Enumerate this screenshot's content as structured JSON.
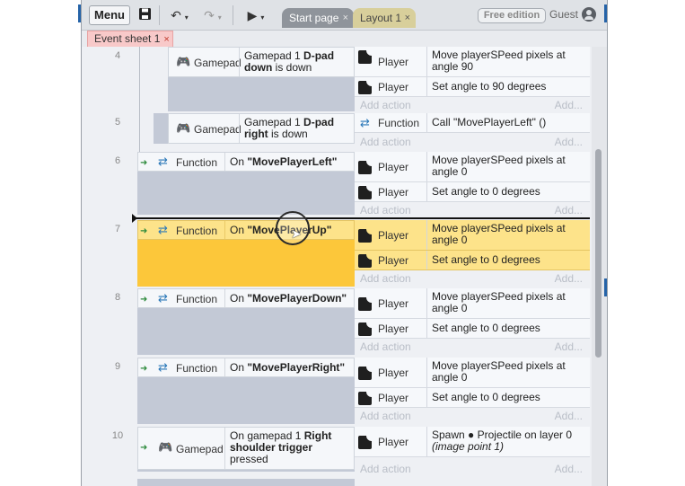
{
  "toolbar": {
    "menu_label": "Menu",
    "save_icon": "floppy-disk-icon",
    "undo_icon": "undo-icon",
    "redo_icon": "redo-icon",
    "play_icon": "play-icon",
    "tabs": [
      {
        "label": "Start page",
        "close": "×"
      },
      {
        "label": "Layout 1",
        "close": "×"
      }
    ],
    "free_badge": "Free edition",
    "user_label": "Guest"
  },
  "sheet_tab": {
    "label": "Event sheet 1",
    "close": "×"
  },
  "events": [
    {
      "number": "4",
      "conditions": [
        {
          "object": "Gamepad",
          "icon": "gamepad-icon",
          "text_plain": "Gamepad 1 ",
          "text_bold": "D-pad down",
          "text_after": " is down"
        }
      ],
      "actions": [
        {
          "object": "Player",
          "icon": "sprite-icon",
          "desc": "Move playerSPeed pixels at",
          "desc2": "angle 90"
        },
        {
          "object": "Player",
          "icon": "sprite-icon",
          "desc": "Set angle to 90 degrees"
        }
      ],
      "add_action_left": "Add action",
      "add_action_right": "Add..."
    },
    {
      "number": "5",
      "conditions": [
        {
          "object": "Gamepad",
          "icon": "gamepad-icon",
          "text_plain": "Gamepad 1 ",
          "text_bold": "D-pad right",
          "text_after": " is down"
        }
      ],
      "actions": [
        {
          "object": "Function",
          "icon": "function-icon",
          "desc": "Call \"MovePlayerLeft\" ()"
        }
      ],
      "add_action_left": "Add action",
      "add_action_right": "Add..."
    },
    {
      "number": "6",
      "conditions": [
        {
          "object": "Function",
          "icon": "function-icon",
          "text_plain": "On ",
          "text_bold": "\"MovePlayerLeft\""
        }
      ],
      "actions": [
        {
          "object": "Player",
          "icon": "sprite-icon",
          "desc": "Move playerSPeed pixels at",
          "desc2": "angle 0"
        },
        {
          "object": "Player",
          "icon": "sprite-icon",
          "desc": "Set angle to 0 degrees"
        }
      ],
      "add_action_left": "Add action",
      "add_action_right": "Add..."
    },
    {
      "number": "7",
      "conditions": [
        {
          "object": "Function",
          "icon": "function-icon",
          "text_plain": "On ",
          "text_bold": "\"MovePlayerUp\""
        }
      ],
      "actions": [
        {
          "object": "Player",
          "icon": "sprite-icon",
          "desc": "Move playerSPeed pixels at",
          "desc2": "angle 0"
        },
        {
          "object": "Player",
          "icon": "sprite-icon",
          "desc": "Set angle to 0 degrees"
        }
      ],
      "add_action_left": "Add action",
      "add_action_right": "Add..."
    },
    {
      "number": "8",
      "conditions": [
        {
          "object": "Function",
          "icon": "function-icon",
          "text_plain": "On ",
          "text_bold": "\"MovePlayerDown\""
        }
      ],
      "actions": [
        {
          "object": "Player",
          "icon": "sprite-icon",
          "desc": "Move playerSPeed pixels at",
          "desc2": "angle 0"
        },
        {
          "object": "Player",
          "icon": "sprite-icon",
          "desc": "Set angle to 0 degrees"
        }
      ],
      "add_action_left": "Add action",
      "add_action_right": "Add..."
    },
    {
      "number": "9",
      "conditions": [
        {
          "object": "Function",
          "icon": "function-icon",
          "text_plain": "On ",
          "text_bold": "\"MovePlayerRight\""
        }
      ],
      "actions": [
        {
          "object": "Player",
          "icon": "sprite-icon",
          "desc": "Move playerSPeed pixels at",
          "desc2": "angle 0"
        },
        {
          "object": "Player",
          "icon": "sprite-icon",
          "desc": "Set angle to 0 degrees"
        }
      ],
      "add_action_left": "Add action",
      "add_action_right": "Add..."
    },
    {
      "number": "10",
      "conditions": [
        {
          "object": "Gamepad",
          "icon": "gamepad-icon",
          "text_plain": "On gamepad 1 ",
          "text_bold": "Right shoulder trigger",
          "text_after": " pressed"
        }
      ],
      "actions": [
        {
          "object": "Player",
          "icon": "sprite-icon",
          "desc": "Spawn ● Projectile on layer 0",
          "desc2": "(image point 1)"
        }
      ],
      "add_action_left": "Add action",
      "add_action_right": "Add..."
    }
  ],
  "colors": {
    "selected": "#fde38a",
    "condition_bg": "#f5f7fa",
    "group_bg": "#c3c9d6",
    "function_icon": "#2b78b8",
    "gamepad_icon": "#1f7d9a"
  }
}
